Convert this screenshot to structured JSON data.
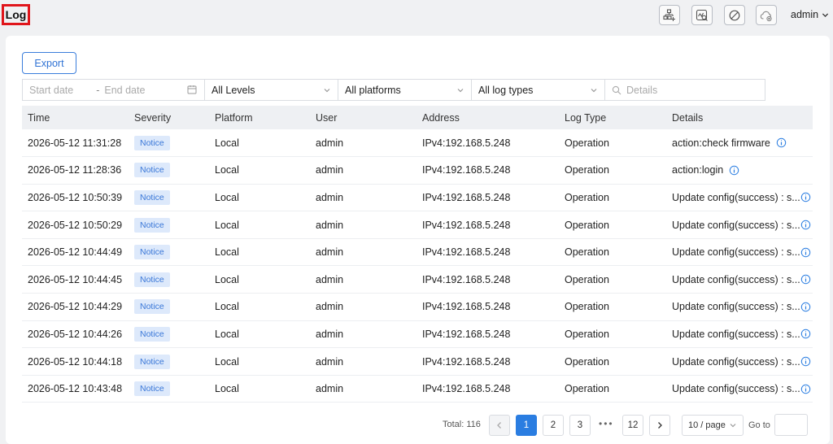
{
  "header": {
    "title": "Log",
    "user": "admin",
    "icons": [
      "network-add-icon",
      "log-search-icon",
      "disable-icon",
      "cloud-offline-icon"
    ]
  },
  "toolbar": {
    "export_label": "Export"
  },
  "filters": {
    "start_date_placeholder": "Start date",
    "separator": "-",
    "end_date_placeholder": "End date",
    "level": "All Levels",
    "platform": "All platforms",
    "log_type": "All log types",
    "details_placeholder": "Details"
  },
  "table": {
    "columns": [
      "Time",
      "Severity",
      "Platform",
      "User",
      "Address",
      "Log Type",
      "Details"
    ],
    "rows": [
      {
        "time": "2026-05-12 11:31:28",
        "severity": "Notice",
        "platform": "Local",
        "user": "admin",
        "address": "IPv4:192.168.5.248",
        "log_type": "Operation",
        "details": "action:check firmware"
      },
      {
        "time": "2026-05-12 11:28:36",
        "severity": "Notice",
        "platform": "Local",
        "user": "admin",
        "address": "IPv4:192.168.5.248",
        "log_type": "Operation",
        "details": "action:login"
      },
      {
        "time": "2026-05-12 10:50:39",
        "severity": "Notice",
        "platform": "Local",
        "user": "admin",
        "address": "IPv4:192.168.5.248",
        "log_type": "Operation",
        "details": "Update config(success) : s..."
      },
      {
        "time": "2026-05-12 10:50:29",
        "severity": "Notice",
        "platform": "Local",
        "user": "admin",
        "address": "IPv4:192.168.5.248",
        "log_type": "Operation",
        "details": "Update config(success) : s..."
      },
      {
        "time": "2026-05-12 10:44:49",
        "severity": "Notice",
        "platform": "Local",
        "user": "admin",
        "address": "IPv4:192.168.5.248",
        "log_type": "Operation",
        "details": "Update config(success) : s..."
      },
      {
        "time": "2026-05-12 10:44:45",
        "severity": "Notice",
        "platform": "Local",
        "user": "admin",
        "address": "IPv4:192.168.5.248",
        "log_type": "Operation",
        "details": "Update config(success) : s..."
      },
      {
        "time": "2026-05-12 10:44:29",
        "severity": "Notice",
        "platform": "Local",
        "user": "admin",
        "address": "IPv4:192.168.5.248",
        "log_type": "Operation",
        "details": "Update config(success) : s..."
      },
      {
        "time": "2026-05-12 10:44:26",
        "severity": "Notice",
        "platform": "Local",
        "user": "admin",
        "address": "IPv4:192.168.5.248",
        "log_type": "Operation",
        "details": "Update config(success) : s..."
      },
      {
        "time": "2026-05-12 10:44:18",
        "severity": "Notice",
        "platform": "Local",
        "user": "admin",
        "address": "IPv4:192.168.5.248",
        "log_type": "Operation",
        "details": "Update config(success) : s..."
      },
      {
        "time": "2026-05-12 10:43:48",
        "severity": "Notice",
        "platform": "Local",
        "user": "admin",
        "address": "IPv4:192.168.5.248",
        "log_type": "Operation",
        "details": "Update config(success) : s..."
      }
    ]
  },
  "pagination": {
    "total_label": "Total: 116",
    "pages": [
      "1",
      "2",
      "3"
    ],
    "ellipsis": "•••",
    "last_page": "12",
    "current_page": "1",
    "page_size": "10 / page",
    "goto_label": "Go to"
  },
  "colors": {
    "accent": "#2a7de1",
    "badge_bg": "#dde9fb",
    "badge_text": "#3b78d8",
    "title_outline": "#e0151b"
  }
}
